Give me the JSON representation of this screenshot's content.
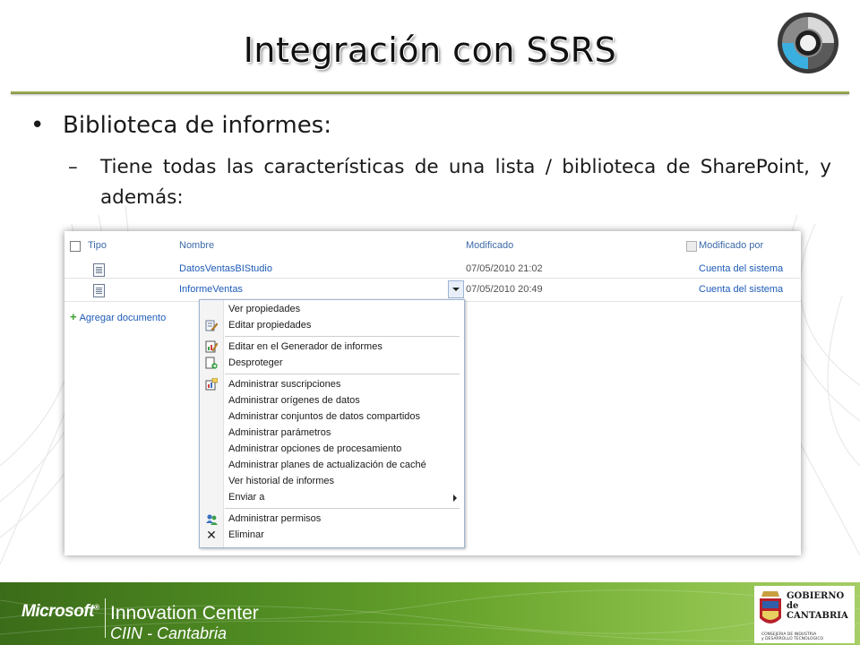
{
  "slide": {
    "title": "Integración con SSRS",
    "bullet_1": "Biblioteca de informes:",
    "bullet_1_marker": "•",
    "bullet_2_marker": "–",
    "bullet_2": "Tiene todas las características de una lista / biblioteca de SharePoint, y además:"
  },
  "sharepoint": {
    "columns": {
      "type": "Tipo",
      "name": "Nombre",
      "modified": "Modificado",
      "modified_by": "Modificado por"
    },
    "rows": [
      {
        "name": "DatosVentasBIStudio",
        "modified": "07/05/2010 21:02",
        "modified_by": "Cuenta del sistema"
      },
      {
        "name": "InformeVentas",
        "modified": "07/05/2010 20:49",
        "modified_by": "Cuenta del sistema"
      }
    ],
    "add_document": "Agregar documento",
    "add_icon": "+",
    "menu": {
      "items": [
        "Ver propiedades",
        "Editar propiedades",
        "Editar en el Generador de informes",
        "Desproteger",
        "Administrar suscripciones",
        "Administrar orígenes de datos",
        "Administrar conjuntos de datos compartidos",
        "Administrar parámetros",
        "Administrar opciones de procesamiento",
        "Administrar planes de actualización de caché",
        "Ver historial de informes",
        "Enviar a",
        "Administrar permisos",
        "Eliminar"
      ],
      "delete_icon": "✕"
    }
  },
  "footer": {
    "microsoft": "Microsoft",
    "trademark": "®",
    "center_title": "Innovation Center",
    "center_sub": "CIIN - Cantabria",
    "gov_line1": "GOBIERNO",
    "gov_line2": "de",
    "gov_line3": "CANTABRIA",
    "gov_dept1": "CONSEJERIA DE INDUSTRIA",
    "gov_dept2": "y DESARROLLO TECNOLOGICO"
  },
  "colors": {
    "accent_rule": "#8a9c45",
    "link": "#1d5bb8",
    "footer_green": "#4f8b22"
  },
  "icons": [
    "logo-disc-icon",
    "checkbox-icon",
    "document-icon",
    "dropdown-arrow-icon",
    "plus-icon",
    "edit-properties-icon",
    "report-builder-icon",
    "checkout-icon",
    "subscriptions-icon",
    "permissions-icon",
    "delete-icon",
    "submenu-arrow-icon",
    "government-shield-icon"
  ]
}
